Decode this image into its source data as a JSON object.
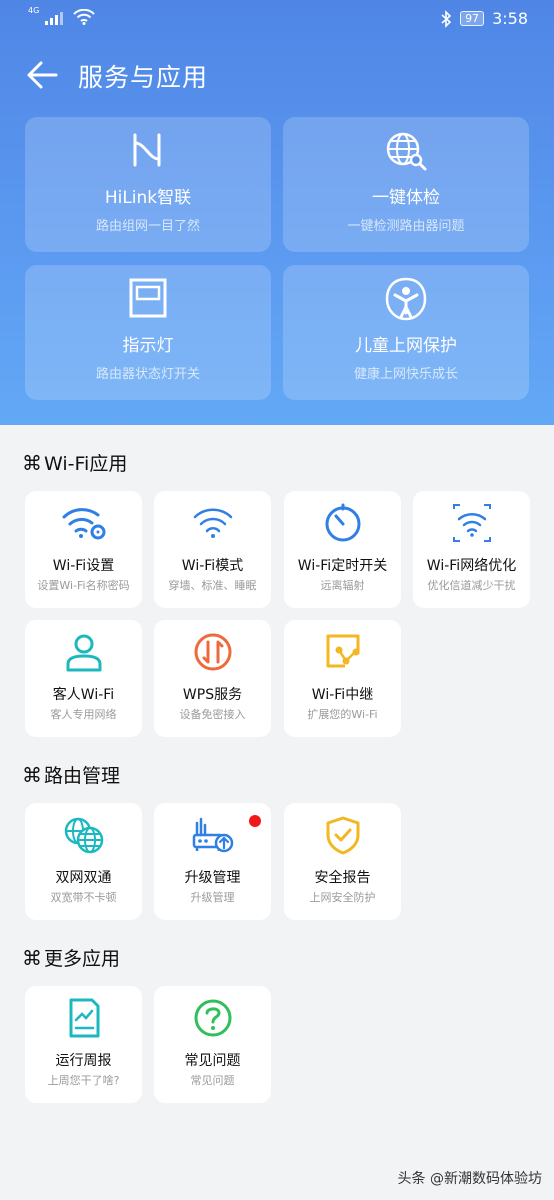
{
  "status_bar": {
    "network": "4G",
    "battery": "97",
    "time": "3:58"
  },
  "header": {
    "title": "服务与应用"
  },
  "featured": [
    {
      "title": "HiLink智联",
      "subtitle": "路由组网一目了然",
      "icon": "hilink-icon"
    },
    {
      "title": "一键体检",
      "subtitle": "一键检测路由器问题",
      "icon": "globe-search-icon"
    },
    {
      "title": "指示灯",
      "subtitle": "路由器状态灯开关",
      "icon": "indicator-light-icon"
    },
    {
      "title": "儿童上网保护",
      "subtitle": "健康上网快乐成长",
      "icon": "child-protect-icon"
    }
  ],
  "sections": [
    {
      "title": "Wi-Fi应用",
      "items": [
        {
          "title": "Wi-Fi设置",
          "subtitle": "设置Wi-Fi名称密码",
          "icon": "wifi-settings-icon"
        },
        {
          "title": "Wi-Fi模式",
          "subtitle": "穿墙、标准、睡眠",
          "icon": "wifi-mode-icon"
        },
        {
          "title": "Wi-Fi定时开关",
          "subtitle": "远离辐射",
          "icon": "timer-icon"
        },
        {
          "title": "Wi-Fi网络优化",
          "subtitle": "优化信道减少干扰",
          "icon": "wifi-optimize-icon"
        },
        {
          "title": "客人Wi-Fi",
          "subtitle": "客人专用网络",
          "icon": "guest-user-icon"
        },
        {
          "title": "WPS服务",
          "subtitle": "设备免密接入",
          "icon": "wps-icon"
        },
        {
          "title": "Wi-Fi中继",
          "subtitle": "扩展您的Wi-Fi",
          "icon": "wifi-relay-icon"
        }
      ]
    },
    {
      "title": "路由管理",
      "items": [
        {
          "title": "双网双通",
          "subtitle": "双宽带不卡顿",
          "icon": "dual-globe-icon"
        },
        {
          "title": "升级管理",
          "subtitle": "升级管理",
          "icon": "router-upgrade-icon"
        },
        {
          "title": "安全报告",
          "subtitle": "上网安全防护",
          "icon": "shield-check-icon"
        }
      ]
    },
    {
      "title": "更多应用",
      "items": [
        {
          "title": "运行周报",
          "subtitle": "上周您干了啥?",
          "icon": "weekly-report-icon"
        },
        {
          "title": "常见问题",
          "subtitle": "常见问题",
          "icon": "question-icon"
        }
      ]
    }
  ],
  "section_glyph": "⌘",
  "watermark": "头条 @新潮数码体验坊",
  "colors": {
    "hero_top": "#4f86e6",
    "hero_bottom": "#63a8f6",
    "wifi_blue": "#2f7fe6",
    "teal": "#1cb8c0",
    "orange": "#ef6a3a",
    "yellow": "#f2b721",
    "green": "#2fbf5b",
    "badge_red": "#f01818"
  }
}
